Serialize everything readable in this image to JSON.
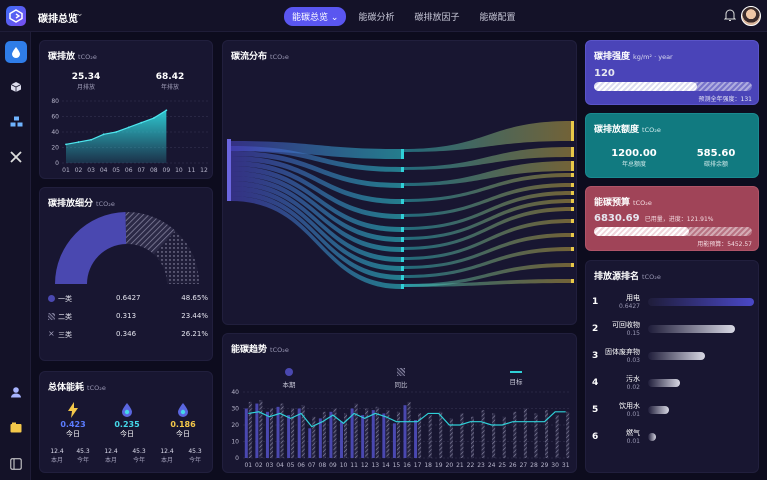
{
  "header": {
    "app_title": "碳排总览",
    "tabs": [
      {
        "label": "能碳总览",
        "active": true
      },
      {
        "label": "能碳分析",
        "active": false
      },
      {
        "label": "碳排放因子",
        "active": false
      },
      {
        "label": "能碳配置",
        "active": false
      }
    ]
  },
  "sidebar": {
    "items": [
      {
        "icon": "drop-icon",
        "active": true
      },
      {
        "icon": "cube-icon",
        "active": false
      },
      {
        "icon": "blocks-icon",
        "active": false
      },
      {
        "icon": "tools-icon",
        "active": false
      },
      {
        "icon": "user-icon",
        "active": false
      },
      {
        "icon": "folder-icon",
        "active": false
      },
      {
        "icon": "panel-icon",
        "active": false
      }
    ]
  },
  "emission_card": {
    "title": "碳排放",
    "unit": "tCO₂e",
    "monthly_value": "25.34",
    "monthly_label": "月排放",
    "yearly_value": "68.42",
    "yearly_label": "年排放",
    "chart_data": {
      "type": "area",
      "x": [
        "01",
        "02",
        "03",
        "04",
        "05",
        "06",
        "07",
        "08",
        "09",
        "10",
        "11",
        "12"
      ],
      "values": [
        24,
        27,
        30,
        37,
        40,
        46,
        52,
        58,
        68,
        null,
        null,
        null
      ],
      "ylim": [
        0,
        80
      ],
      "yticks": [
        0,
        20,
        40,
        60,
        80
      ]
    }
  },
  "breakdown_card": {
    "title": "碳排放细分",
    "unit": "tCO₂e",
    "chart_data": {
      "type": "pie",
      "categories": [
        "一类",
        "二类",
        "三类"
      ],
      "values": [
        0.6427,
        0.313,
        0.346
      ],
      "percents": [
        "48.65%",
        "23.44%",
        "26.21%"
      ]
    },
    "legend": [
      {
        "name": "一类",
        "value": "0.6427",
        "percent": "48.65%"
      },
      {
        "name": "二类",
        "value": "0.313",
        "percent": "23.44%"
      },
      {
        "name": "三类",
        "value": "0.346",
        "percent": "26.21%"
      }
    ]
  },
  "consumption_card": {
    "title": "总体能耗",
    "unit": "tCO₂e",
    "items": [
      {
        "icon": "lightning-icon",
        "value": "0.423",
        "label": "今日",
        "month_value": "12.4",
        "month_label": "本月",
        "year_value": "45.3",
        "year_label": "今年",
        "color": "#5b7cff"
      },
      {
        "icon": "water-drop-icon",
        "value": "0.235",
        "label": "今日",
        "month_value": "12.4",
        "month_label": "本月",
        "year_value": "45.3",
        "year_label": "今年",
        "color": "#45d8e8"
      },
      {
        "icon": "fire-icon",
        "value": "0.186",
        "label": "今日",
        "month_value": "12.4",
        "month_label": "本月",
        "year_value": "45.3",
        "year_label": "今年",
        "color": "#f4c84a"
      }
    ]
  },
  "sankey_card": {
    "title": "碳流分布",
    "unit": "tCO₂e"
  },
  "trend_card": {
    "title": "能碳趋势",
    "unit": "tCO₂e",
    "legend": [
      {
        "name": "本期"
      },
      {
        "name": "同比"
      },
      {
        "name": "目标"
      }
    ],
    "chart_data": {
      "type": "bar",
      "x": [
        "01",
        "02",
        "03",
        "04",
        "05",
        "06",
        "07",
        "08",
        "09",
        "10",
        "11",
        "12",
        "13",
        "14",
        "15",
        "16",
        "17",
        "18",
        "19",
        "20",
        "21",
        "22",
        "23",
        "24",
        "25",
        "26",
        "27",
        "28",
        "29",
        "30",
        "31"
      ],
      "series": [
        {
          "name": "本期",
          "values": [
            30,
            33,
            28,
            31,
            26,
            30,
            18,
            24,
            28,
            22,
            30,
            26,
            29,
            27,
            21,
            32,
            23,
            0,
            0,
            0,
            0,
            0,
            0,
            0,
            0,
            0,
            0,
            0,
            0,
            0,
            0
          ]
        },
        {
          "name": "同比",
          "values": [
            34,
            35,
            30,
            33,
            30,
            32,
            25,
            28,
            30,
            27,
            33,
            30,
            31,
            29,
            28,
            34,
            27,
            26,
            28,
            24,
            27,
            25,
            29,
            27,
            25,
            28,
            30,
            27,
            29,
            26,
            28
          ]
        },
        {
          "name": "目标",
          "values": [
            27,
            28,
            25,
            27,
            24,
            27,
            19,
            22,
            26,
            21,
            27,
            24,
            27,
            25,
            22,
            22,
            22,
            27,
            27,
            20,
            20,
            22,
            22,
            20,
            20,
            22,
            22,
            22,
            22,
            28,
            28
          ]
        }
      ],
      "ylim": [
        0,
        40
      ],
      "yticks": [
        0,
        10,
        20,
        30,
        40
      ]
    }
  },
  "intensity_card": {
    "title": "碳排强度",
    "unit": "kg/m² · year",
    "value": "120",
    "progress": 0.65,
    "footer": "预测全年强度：131",
    "color": "#4a44b8"
  },
  "quota_card": {
    "title": "碳排放额度",
    "unit": "tCO₂e",
    "annual_value": "1200.00",
    "annual_label": "年总额度",
    "remain_value": "585.60",
    "remain_label": "碳排余额",
    "color": "#117a80"
  },
  "budget_card": {
    "title": "能碳预算",
    "unit": "tCO₂e",
    "value": "6830.69",
    "used_text": "已用量，进度：121.91%",
    "progress": 0.6,
    "footer": "用能预算：5452.57",
    "color": "#a04458"
  },
  "ranking_card": {
    "title": "排放源排名",
    "unit": "tCO₂e",
    "items": [
      {
        "rank": "1",
        "name": "用电",
        "value": "0.6427",
        "share": 1.0
      },
      {
        "rank": "2",
        "name": "可回收物",
        "value": "0.15",
        "share": 0.82
      },
      {
        "rank": "3",
        "name": "固体废弃物",
        "value": "0.03",
        "share": 0.54
      },
      {
        "rank": "4",
        "name": "污水",
        "value": "0.02",
        "share": 0.3
      },
      {
        "rank": "5",
        "name": "饮用水",
        "value": "0.01",
        "share": 0.2
      },
      {
        "rank": "6",
        "name": "燃气",
        "value": "0.01",
        "share": 0.08
      }
    ]
  }
}
